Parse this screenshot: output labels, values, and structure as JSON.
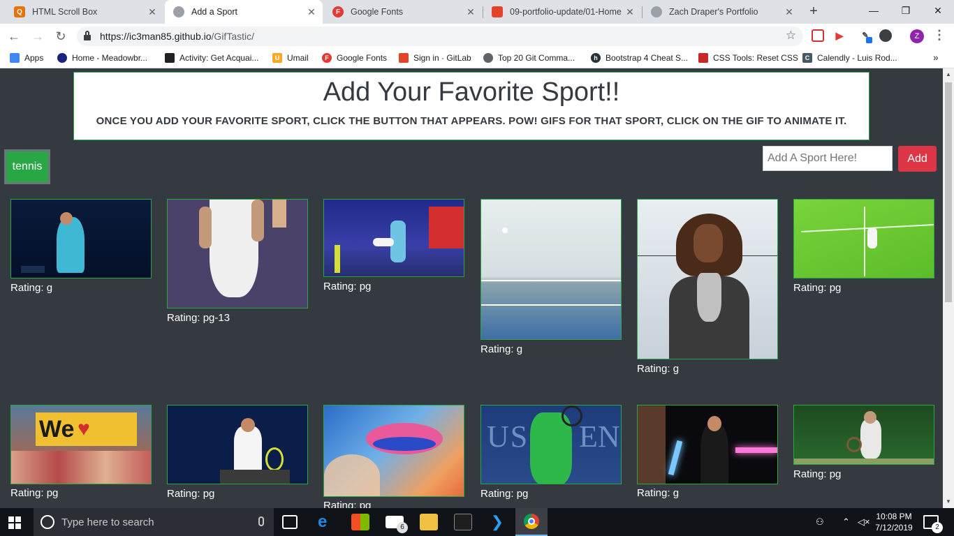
{
  "browser": {
    "tabs": [
      {
        "title": "HTML Scroll Box",
        "favicon": "orange-square-icon",
        "color": "#e8710a"
      },
      {
        "title": "Add a Sport",
        "favicon": "globe-icon",
        "color": "#9aa0a6"
      },
      {
        "title": "Google Fonts",
        "favicon": "google-fonts-icon",
        "color": "#e53935"
      },
      {
        "title": "09-portfolio-update/01-Home",
        "favicon": "gitlab-icon",
        "color": "#e24329"
      },
      {
        "title": "Zach Draper's Portfolio",
        "favicon": "globe-icon",
        "color": "#9aa0a6"
      }
    ],
    "url_host": "https://ic3man85.github.io",
    "url_path": "/GifTastic/",
    "bookmarks": [
      {
        "label": "Apps",
        "icon": "apps-grid-icon",
        "color": "#4285f4"
      },
      {
        "label": "Home - Meadowbr...",
        "icon": "meadowbrook-icon",
        "color": "#1a237e"
      },
      {
        "label": "Activity: Get Acquai...",
        "icon": "book-icon",
        "color": "#202124"
      },
      {
        "label": "Umail",
        "icon": "umail-icon",
        "color": "#f9a825"
      },
      {
        "label": "Google Fonts",
        "icon": "google-fonts-icon",
        "color": "#e53935"
      },
      {
        "label": "Sign in · GitLab",
        "icon": "gitlab-icon",
        "color": "#e24329"
      },
      {
        "label": "Top 20 Git Comma...",
        "icon": "git-icon",
        "color": "#5f6368"
      },
      {
        "label": "Bootstrap 4 Cheat S...",
        "icon": "bootstrap-icon",
        "color": "#263238"
      },
      {
        "label": "CSS Tools: Reset CSS",
        "icon": "css-tools-icon",
        "color": "#c62828"
      },
      {
        "label": "Calendly - Luis Rod...",
        "icon": "calendly-icon",
        "color": "#455a64"
      }
    ],
    "profile_initial": "Z"
  },
  "page": {
    "title": "Add Your Favorite Sport!!",
    "subtitle": "ONCE YOU ADD YOUR FAVORITE SPORT, CLICK THE BUTTON THAT APPEARS. POW! GIFS FOR THAT SPORT, CLICK ON THE GIF TO ANIMATE IT.",
    "sport_buttons": [
      "tennis"
    ],
    "input_placeholder": "Add A Sport Here!",
    "add_label": "Add",
    "accent_green": "#28a745",
    "accent_red": "#dc3545"
  },
  "gifs": [
    {
      "rating": "Rating: g",
      "scene": "tennis-player-dark-court"
    },
    {
      "rating": "Rating: pg-13",
      "scene": "tennis-player-white-shorts"
    },
    {
      "rating": "Rating: pg",
      "scene": "exhibition-match-red-stands"
    },
    {
      "rating": "Rating: g",
      "scene": "indoor-court-white-dome"
    },
    {
      "rating": "Rating: g",
      "scene": "champion-with-trophy"
    },
    {
      "rating": "Rating: pg",
      "scene": "video-game-tennis-grass"
    },
    {
      "rating": "Rating: pg",
      "scene": "crowd-we-love-rafa-sign"
    },
    {
      "rating": "Rating: pg",
      "scene": "player-on-bench-racket"
    },
    {
      "rating": "Rating: pg",
      "scene": "tennis-ball-closeup"
    },
    {
      "rating": "Rating: pg",
      "scene": "us-open-forehand"
    },
    {
      "rating": "Rating: g",
      "scene": "lightsaber-dance"
    },
    {
      "rating": "Rating: pg",
      "scene": "player-on-grass-hedge"
    }
  ],
  "taskbar": {
    "search_placeholder": "Type here to search",
    "mail_badge": "6",
    "time": "10:08 PM",
    "date": "7/12/2019",
    "notifications": "2"
  }
}
